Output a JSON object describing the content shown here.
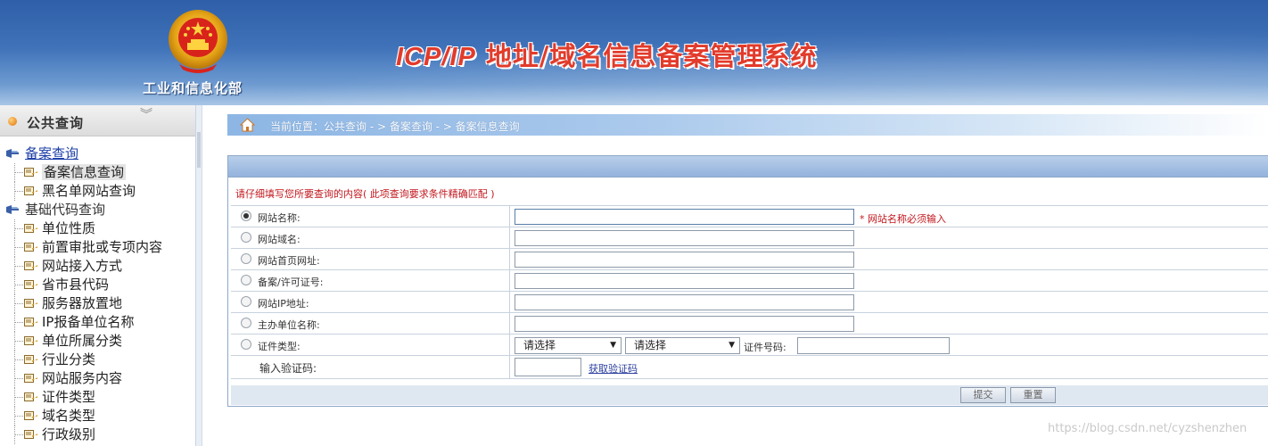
{
  "header": {
    "ministry": "工业和信息化部",
    "title_latin": "ICP/IP",
    "title_rest": " 地址/域名信息备案管理系统",
    "emblem_icon": "national-emblem-icon"
  },
  "sidebar": {
    "title": "公共查询",
    "collapse_glyph": "︾",
    "groups": [
      {
        "label": "备案查询",
        "items": [
          "备案信息查询",
          "黑名单网站查询"
        ]
      },
      {
        "label": "基础代码查询",
        "items": [
          "单位性质",
          "前置审批或专项内容",
          "网站接入方式",
          "省市县代码",
          "服务器放置地",
          "IP报备单位名称",
          "单位所属分类",
          "行业分类",
          "网站服务内容",
          "证件类型",
          "域名类型",
          "行政级别"
        ]
      }
    ]
  },
  "breadcrumb": {
    "text": "当前位置：公共查询  - >  备案查询  - > 备案信息查询"
  },
  "form": {
    "notice": "请仔细填写您所要查询的内容( 此项查询要求条件精确匹配 )",
    "rows": [
      {
        "label": "网站名称:",
        "checked": true,
        "value": ""
      },
      {
        "label": "网站域名:",
        "checked": false,
        "value": ""
      },
      {
        "label": "网站首页网址:",
        "checked": false,
        "value": ""
      },
      {
        "label": "备案/许可证号:",
        "checked": false,
        "value": ""
      },
      {
        "label": "网站IP地址:",
        "checked": false,
        "value": ""
      },
      {
        "label": "主办单位名称:",
        "checked": false,
        "value": ""
      }
    ],
    "required_hint": "* 网站名称必须输入",
    "cert_type_label": "证件类型:",
    "cert_select_1": "请选择",
    "cert_select_2": "请选择",
    "cert_number_label": "证件号码:",
    "captcha_label": "输入验证码:",
    "captcha_link": "获取验证码",
    "submit": "提交",
    "reset": "重置"
  },
  "watermark": "https://blog.csdn.net/cyzshenzhen",
  "colors": {
    "header_blue": "#3f72b9",
    "title_red": "#e23b2b",
    "notice_red": "#c2171d",
    "link_blue": "#1d3fa7"
  }
}
